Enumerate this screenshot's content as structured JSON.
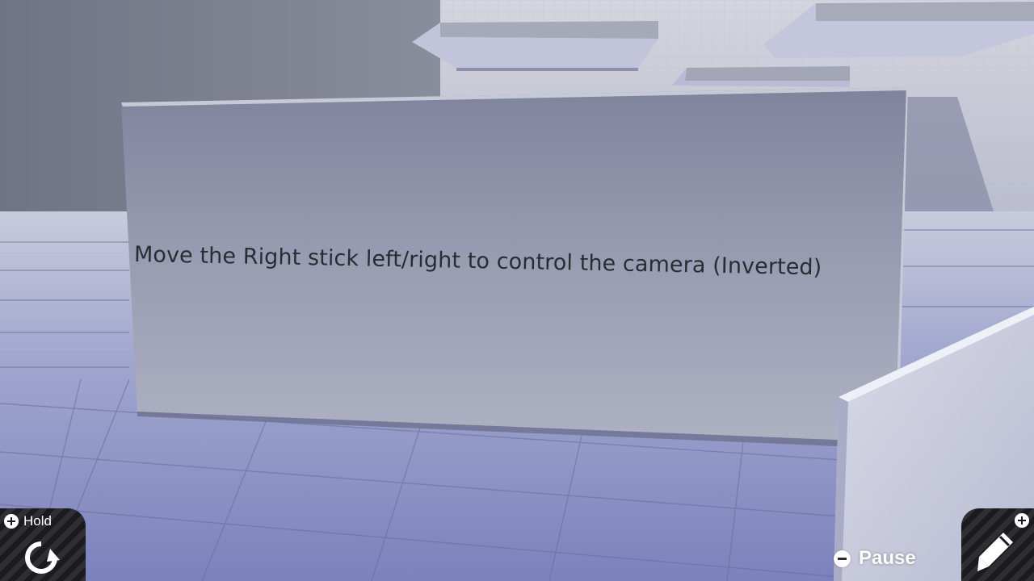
{
  "sign": {
    "text": "Move the Right stick left/right to control the camera (Inverted)"
  },
  "hud": {
    "hold": {
      "button_icon": "plus-button-icon",
      "label": "Hold",
      "action_icon": "rotate-icon"
    },
    "pause": {
      "button_icon": "minus-button-icon",
      "label": "Pause"
    },
    "edit": {
      "button_icon": "plus-button-icon",
      "action_icon": "pencil-icon"
    }
  },
  "colors": {
    "floor": "#7f86bd",
    "sign_face": "#8a8fa8",
    "hud_dark": "#1b1b1f",
    "hud_text": "#ffffff"
  }
}
